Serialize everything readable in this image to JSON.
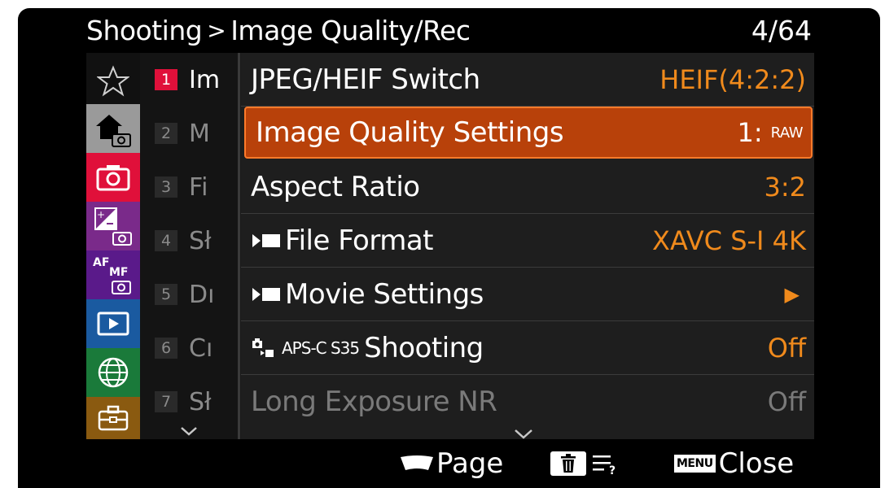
{
  "header": {
    "breadcrumb_root": "Shooting",
    "separator": ">",
    "breadcrumb_section": "Image Quality/Rec",
    "page_counter": "4/64"
  },
  "tabs": [
    {
      "icon": "star-icon",
      "color": "#111111"
    },
    {
      "icon": "home-camera-icon",
      "color": "#9a9a9a"
    },
    {
      "icon": "camera-icon",
      "color": "#e0103a"
    },
    {
      "icon": "exposure-camera-icon",
      "color": "#7a2a8a"
    },
    {
      "icon": "af-mf-camera-icon",
      "color": "#5a1a8a"
    },
    {
      "icon": "playback-icon",
      "color": "#1a5aa0"
    },
    {
      "icon": "globe-icon",
      "color": "#1a7a3a"
    },
    {
      "icon": "toolbox-icon",
      "color": "#8a5a10"
    }
  ],
  "subitems": [
    {
      "num": "1",
      "text": "Im"
    },
    {
      "num": "2",
      "text": "M"
    },
    {
      "num": "3",
      "text": "Fi"
    },
    {
      "num": "4",
      "text": "Sł"
    },
    {
      "num": "5",
      "text": "Dı"
    },
    {
      "num": "6",
      "text": "Cı"
    },
    {
      "num": "7",
      "text": "Sł"
    }
  ],
  "rows": [
    {
      "label": "JPEG/HEIF Switch",
      "value": "HEIF(4:2:2)"
    },
    {
      "label": "Image Quality Settings",
      "value": "1:",
      "value_tag": "RAW"
    },
    {
      "label": "Aspect Ratio",
      "value": "3:2"
    },
    {
      "label": "File Format",
      "value": "XAVC S-I 4K"
    },
    {
      "label": "Movie Settings",
      "value": "▶"
    },
    {
      "label_prefix": "APS-C S35",
      "label": "Shooting",
      "value": "Off"
    },
    {
      "label": "Long Exposure NR",
      "value": "Off"
    }
  ],
  "footer": {
    "page_label": "Page",
    "menu_key": "MENU",
    "close_label": "Close"
  },
  "colors": {
    "accent_orange": "#f08a1c",
    "selected_bg": "#b8410a",
    "active_number": "#e0103a"
  }
}
